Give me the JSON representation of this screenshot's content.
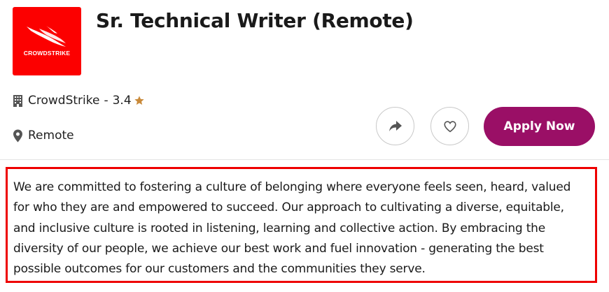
{
  "logo": {
    "text": "CROWDSTRIKE",
    "background": "#fc0000"
  },
  "job": {
    "title": "Sr. Technical Writer (Remote)",
    "company": "CrowdStrike",
    "separator": "-",
    "rating": "3.4",
    "location": "Remote"
  },
  "icons": {
    "company": "building-icon",
    "rating": "star-icon",
    "location": "map-pin-icon",
    "share": "share-arrow-icon",
    "save": "heart-icon"
  },
  "actions": {
    "apply_label": "Apply Now"
  },
  "colors": {
    "accent": "#9a0f66",
    "star": "#c98a3a",
    "highlight_border": "#ee0000"
  },
  "description": {
    "text": "We are committed to fostering a culture of belonging where everyone feels seen, heard, valued for who they are and empowered to succeed. Our approach to cultivating a diverse, equitable, and inclusive culture is rooted in listening, learning and collective action. By embracing the diversity of our people, we achieve our best work and fuel innovation - generating the best possible outcomes for our customers and the communities they serve."
  }
}
